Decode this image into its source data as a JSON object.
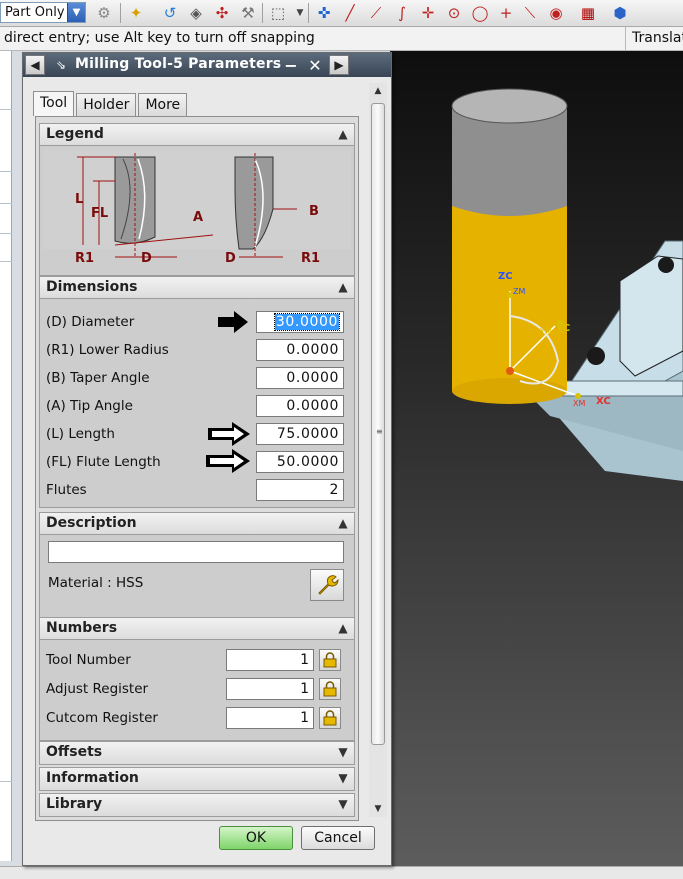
{
  "toolbar": {
    "filter_value": "Part Only",
    "icons": [
      "gear-icon",
      "snap-point-icon",
      "undo-arrow-icon",
      "box-icon",
      "transform-icon",
      "wrench-icon",
      "select-box-icon",
      "point-icon",
      "line-icon",
      "curve-icon",
      "intersect-icon",
      "center-icon",
      "circle-icon",
      "plus-icon",
      "tangent-icon",
      "view-icon",
      "grid-icon",
      "cube-icon"
    ]
  },
  "cue": {
    "message": "direct entry; use Alt key to turn off snapping",
    "right_text": "Translat"
  },
  "dialog": {
    "title": "Milling Tool-5 Parameters",
    "tabs": [
      {
        "label": "Tool",
        "active": true
      },
      {
        "label": "Holder",
        "active": false
      },
      {
        "label": "More",
        "active": false
      }
    ],
    "legend": {
      "header": "Legend",
      "labels": {
        "L": "L",
        "FL": "FL",
        "A": "A",
        "R1_left": "R1",
        "D_left": "D",
        "B": "B",
        "D_right": "D",
        "R1_right": "R1"
      }
    },
    "dimensions": {
      "header": "Dimensions",
      "rows": [
        {
          "label": "(D) Diameter",
          "value": "30.0000",
          "selected": true
        },
        {
          "label": "(R1) Lower Radius",
          "value": "0.0000"
        },
        {
          "label": "(B) Taper Angle",
          "value": "0.0000"
        },
        {
          "label": "(A) Tip Angle",
          "value": "0.0000"
        },
        {
          "label": "(L) Length",
          "value": "75.0000"
        },
        {
          "label": "(FL) Flute Length",
          "value": "50.0000"
        },
        {
          "label": "Flutes",
          "value": "2"
        }
      ]
    },
    "description": {
      "header": "Description",
      "text": "",
      "material": "Material : HSS"
    },
    "numbers": {
      "header": "Numbers",
      "rows": [
        {
          "label": "Tool Number",
          "value": "1"
        },
        {
          "label": "Adjust Register",
          "value": "1"
        },
        {
          "label": "Cutcom Register",
          "value": "1"
        }
      ]
    },
    "collapsed_groups": [
      "Offsets",
      "Information",
      "Library"
    ],
    "ok_label": "OK",
    "cancel_label": "Cancel"
  },
  "viewport": {
    "axis_labels": {
      "zc": "ZC",
      "yc": "YC",
      "xc": "XC",
      "zm": "ZM",
      "ym": "YM",
      "xm": "XM"
    },
    "colors": {
      "tool_body": "#e8b400",
      "tool_shank": "#9a9a9a",
      "workpiece": "#b9d3df",
      "axis_z": "#2b50ff",
      "axis_y": "#d9c000",
      "axis_x": "#e0322a"
    }
  }
}
